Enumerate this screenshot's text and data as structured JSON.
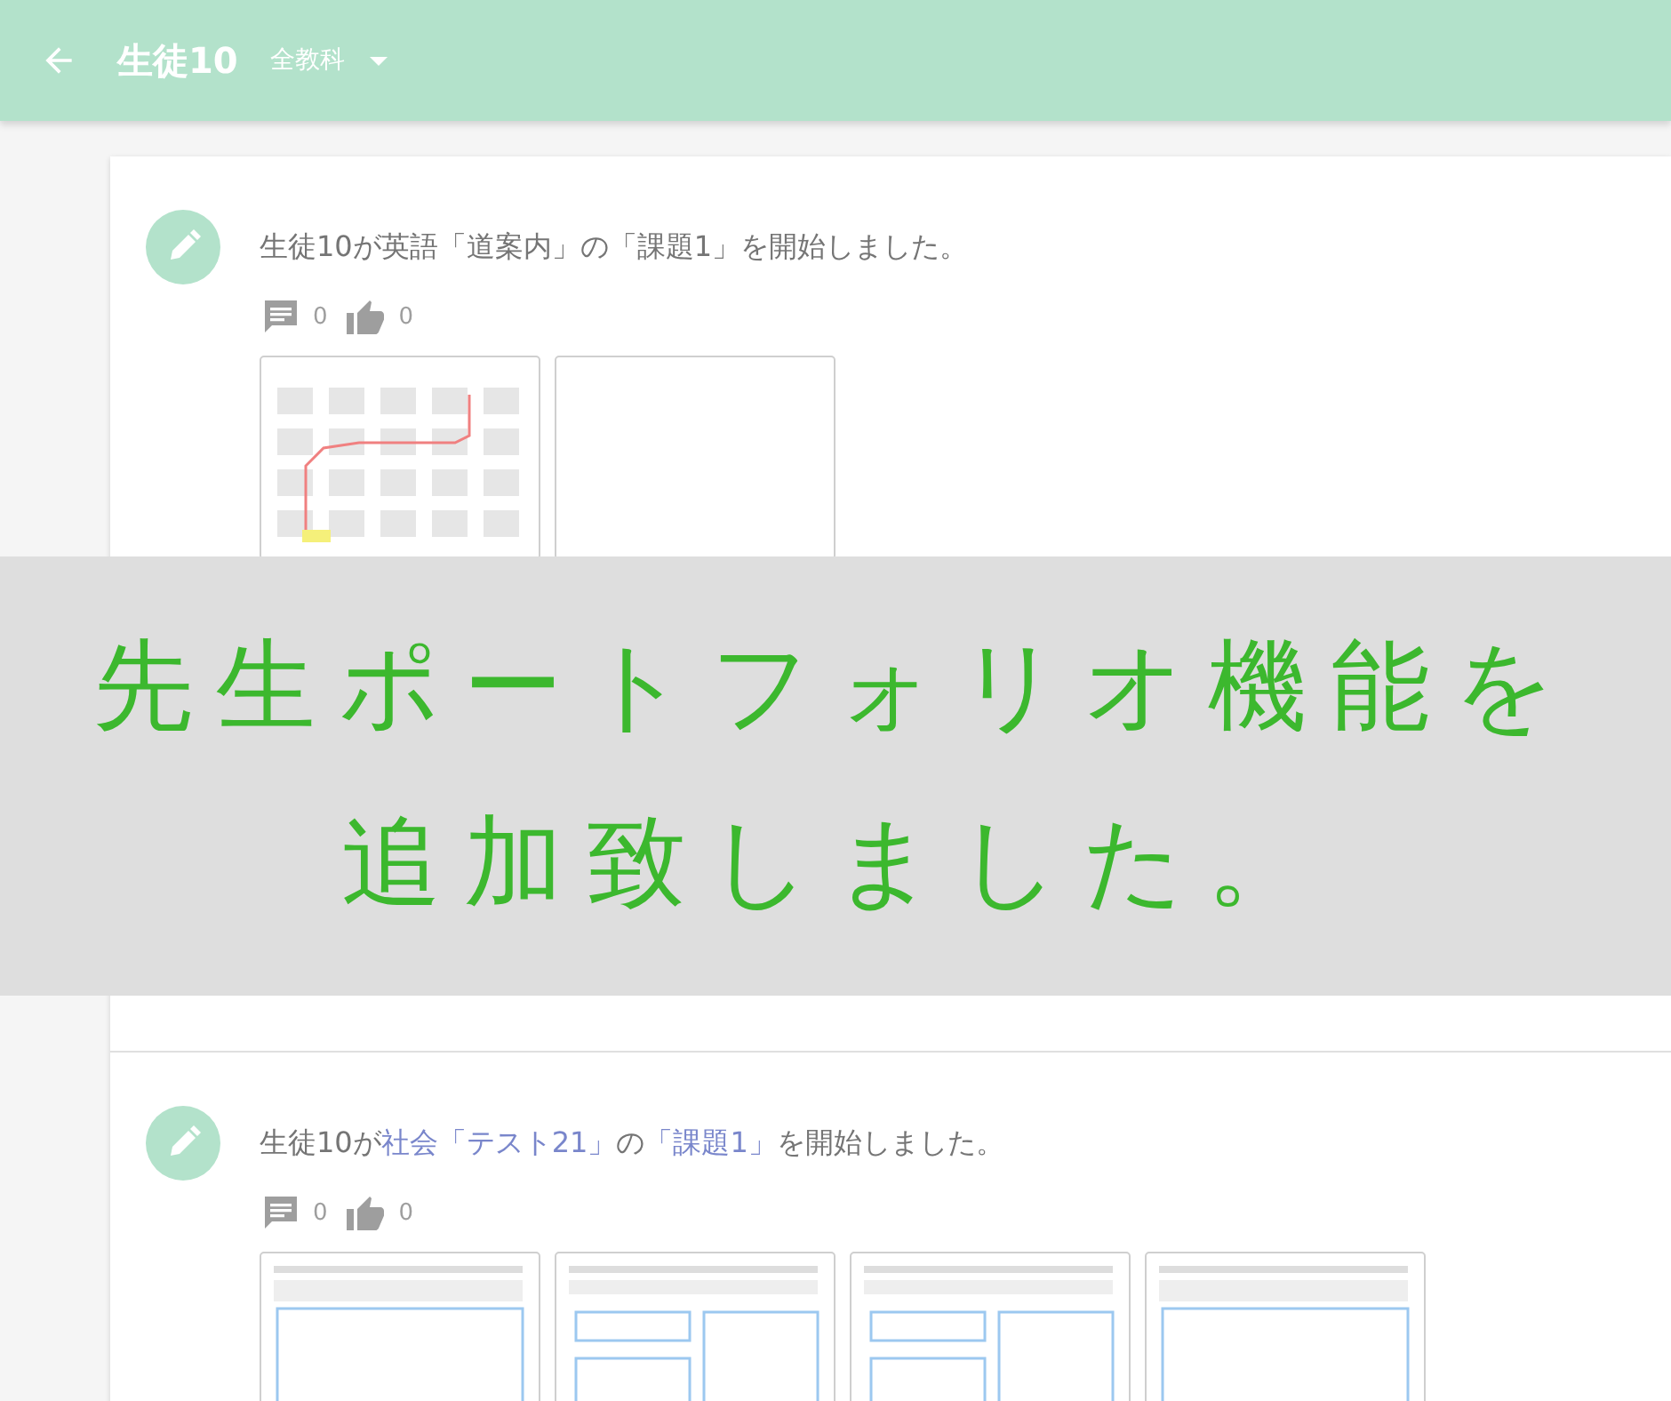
{
  "app_bar": {
    "title": "生徒10",
    "filter": "全教科"
  },
  "posts": [
    {
      "message": [
        {
          "text": "生徒10が英語「道案内」の「課題1」を開始しました。",
          "link": false
        }
      ],
      "comments": "0",
      "likes": "0",
      "thumbnails": [
        {
          "kind": "map"
        },
        {
          "kind": "blank"
        }
      ]
    },
    {
      "message": [
        {
          "text": "生徒10が",
          "link": false
        },
        {
          "text": "社会「テスト21」",
          "link": true
        },
        {
          "text": "の",
          "link": false
        },
        {
          "text": "「課題1」",
          "link": true
        },
        {
          "text": "を開始しました。",
          "link": false
        }
      ],
      "comments": "0",
      "likes": "0",
      "thumbnails": [
        {
          "kind": "worksheet"
        },
        {
          "kind": "form"
        },
        {
          "kind": "form"
        },
        {
          "kind": "worksheet"
        }
      ]
    }
  ],
  "banner": {
    "lines": [
      "先生ポートフォリオ機能を",
      "追加致しました。"
    ]
  }
}
